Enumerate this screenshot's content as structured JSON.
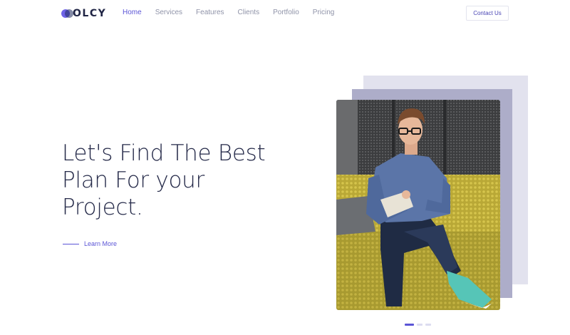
{
  "logo": {
    "text": "OLCY",
    "icon": "overlapping-circles-logo"
  },
  "nav": {
    "items": [
      {
        "label": "Home",
        "active": true
      },
      {
        "label": "Services"
      },
      {
        "label": "Features"
      },
      {
        "label": "Clients"
      },
      {
        "label": "Portfolio"
      },
      {
        "label": "Pricing"
      }
    ],
    "contact_label": "Contact Us"
  },
  "hero": {
    "title_lines": [
      "Let's Find The Best",
      "Plan For your",
      "Project."
    ],
    "learn_more": "Learn More"
  },
  "slider": {
    "count": 3,
    "active_index": 0
  },
  "colors": {
    "accent": "#5b55d6",
    "title": "#252a49",
    "nav_text": "#8f93a8",
    "couch": "#c9b73f",
    "shirt": "#5b75a8"
  }
}
